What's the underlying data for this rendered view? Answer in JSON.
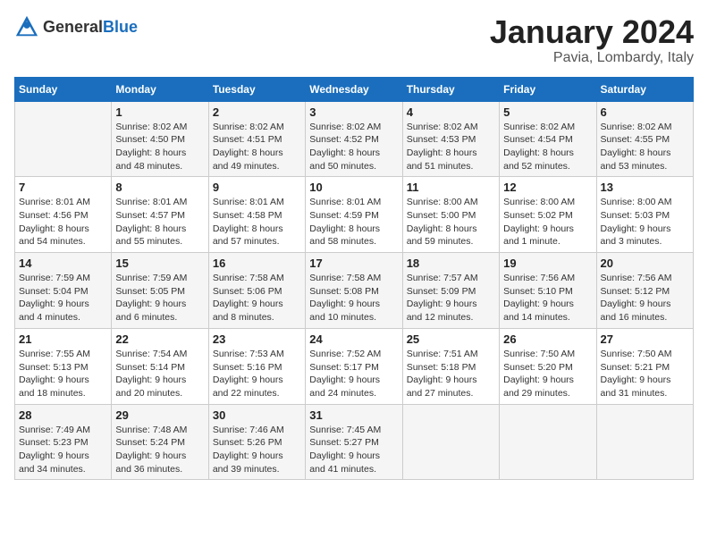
{
  "header": {
    "logo_general": "General",
    "logo_blue": "Blue",
    "title": "January 2024",
    "location": "Pavia, Lombardy, Italy"
  },
  "days_of_week": [
    "Sunday",
    "Monday",
    "Tuesday",
    "Wednesday",
    "Thursday",
    "Friday",
    "Saturday"
  ],
  "weeks": [
    [
      {
        "day": "",
        "info": ""
      },
      {
        "day": "1",
        "info": "Sunrise: 8:02 AM\nSunset: 4:50 PM\nDaylight: 8 hours\nand 48 minutes."
      },
      {
        "day": "2",
        "info": "Sunrise: 8:02 AM\nSunset: 4:51 PM\nDaylight: 8 hours\nand 49 minutes."
      },
      {
        "day": "3",
        "info": "Sunrise: 8:02 AM\nSunset: 4:52 PM\nDaylight: 8 hours\nand 50 minutes."
      },
      {
        "day": "4",
        "info": "Sunrise: 8:02 AM\nSunset: 4:53 PM\nDaylight: 8 hours\nand 51 minutes."
      },
      {
        "day": "5",
        "info": "Sunrise: 8:02 AM\nSunset: 4:54 PM\nDaylight: 8 hours\nand 52 minutes."
      },
      {
        "day": "6",
        "info": "Sunrise: 8:02 AM\nSunset: 4:55 PM\nDaylight: 8 hours\nand 53 minutes."
      }
    ],
    [
      {
        "day": "7",
        "info": "Sunrise: 8:01 AM\nSunset: 4:56 PM\nDaylight: 8 hours\nand 54 minutes."
      },
      {
        "day": "8",
        "info": "Sunrise: 8:01 AM\nSunset: 4:57 PM\nDaylight: 8 hours\nand 55 minutes."
      },
      {
        "day": "9",
        "info": "Sunrise: 8:01 AM\nSunset: 4:58 PM\nDaylight: 8 hours\nand 57 minutes."
      },
      {
        "day": "10",
        "info": "Sunrise: 8:01 AM\nSunset: 4:59 PM\nDaylight: 8 hours\nand 58 minutes."
      },
      {
        "day": "11",
        "info": "Sunrise: 8:00 AM\nSunset: 5:00 PM\nDaylight: 8 hours\nand 59 minutes."
      },
      {
        "day": "12",
        "info": "Sunrise: 8:00 AM\nSunset: 5:02 PM\nDaylight: 9 hours\nand 1 minute."
      },
      {
        "day": "13",
        "info": "Sunrise: 8:00 AM\nSunset: 5:03 PM\nDaylight: 9 hours\nand 3 minutes."
      }
    ],
    [
      {
        "day": "14",
        "info": "Sunrise: 7:59 AM\nSunset: 5:04 PM\nDaylight: 9 hours\nand 4 minutes."
      },
      {
        "day": "15",
        "info": "Sunrise: 7:59 AM\nSunset: 5:05 PM\nDaylight: 9 hours\nand 6 minutes."
      },
      {
        "day": "16",
        "info": "Sunrise: 7:58 AM\nSunset: 5:06 PM\nDaylight: 9 hours\nand 8 minutes."
      },
      {
        "day": "17",
        "info": "Sunrise: 7:58 AM\nSunset: 5:08 PM\nDaylight: 9 hours\nand 10 minutes."
      },
      {
        "day": "18",
        "info": "Sunrise: 7:57 AM\nSunset: 5:09 PM\nDaylight: 9 hours\nand 12 minutes."
      },
      {
        "day": "19",
        "info": "Sunrise: 7:56 AM\nSunset: 5:10 PM\nDaylight: 9 hours\nand 14 minutes."
      },
      {
        "day": "20",
        "info": "Sunrise: 7:56 AM\nSunset: 5:12 PM\nDaylight: 9 hours\nand 16 minutes."
      }
    ],
    [
      {
        "day": "21",
        "info": "Sunrise: 7:55 AM\nSunset: 5:13 PM\nDaylight: 9 hours\nand 18 minutes."
      },
      {
        "day": "22",
        "info": "Sunrise: 7:54 AM\nSunset: 5:14 PM\nDaylight: 9 hours\nand 20 minutes."
      },
      {
        "day": "23",
        "info": "Sunrise: 7:53 AM\nSunset: 5:16 PM\nDaylight: 9 hours\nand 22 minutes."
      },
      {
        "day": "24",
        "info": "Sunrise: 7:52 AM\nSunset: 5:17 PM\nDaylight: 9 hours\nand 24 minutes."
      },
      {
        "day": "25",
        "info": "Sunrise: 7:51 AM\nSunset: 5:18 PM\nDaylight: 9 hours\nand 27 minutes."
      },
      {
        "day": "26",
        "info": "Sunrise: 7:50 AM\nSunset: 5:20 PM\nDaylight: 9 hours\nand 29 minutes."
      },
      {
        "day": "27",
        "info": "Sunrise: 7:50 AM\nSunset: 5:21 PM\nDaylight: 9 hours\nand 31 minutes."
      }
    ],
    [
      {
        "day": "28",
        "info": "Sunrise: 7:49 AM\nSunset: 5:23 PM\nDaylight: 9 hours\nand 34 minutes."
      },
      {
        "day": "29",
        "info": "Sunrise: 7:48 AM\nSunset: 5:24 PM\nDaylight: 9 hours\nand 36 minutes."
      },
      {
        "day": "30",
        "info": "Sunrise: 7:46 AM\nSunset: 5:26 PM\nDaylight: 9 hours\nand 39 minutes."
      },
      {
        "day": "31",
        "info": "Sunrise: 7:45 AM\nSunset: 5:27 PM\nDaylight: 9 hours\nand 41 minutes."
      },
      {
        "day": "",
        "info": ""
      },
      {
        "day": "",
        "info": ""
      },
      {
        "day": "",
        "info": ""
      }
    ]
  ]
}
